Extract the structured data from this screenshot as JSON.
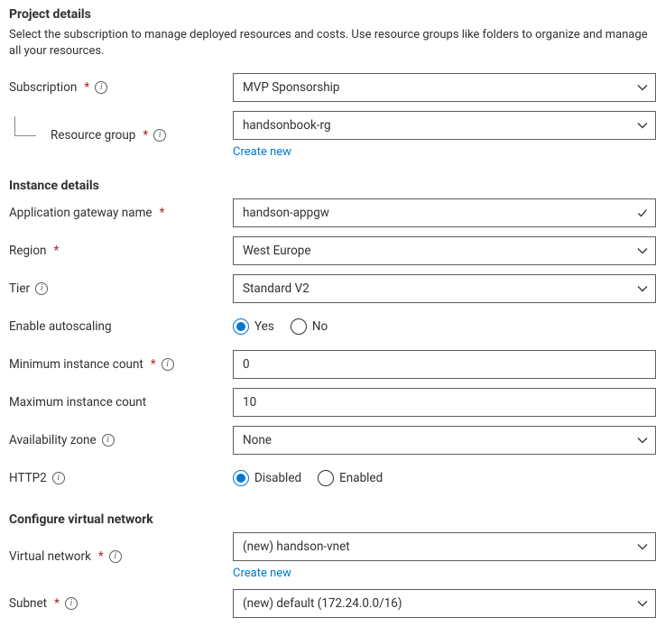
{
  "projectDetails": {
    "heading": "Project details",
    "description": "Select the subscription to manage deployed resources and costs. Use resource groups like folders to organize and manage all your resources.",
    "subscription": {
      "label": "Subscription",
      "value": "MVP Sponsorship"
    },
    "resourceGroup": {
      "label": "Resource group",
      "value": "handsonbook-rg",
      "createNew": "Create new"
    }
  },
  "instanceDetails": {
    "heading": "Instance details",
    "name": {
      "label": "Application gateway name",
      "value": "handson-appgw"
    },
    "region": {
      "label": "Region",
      "value": "West Europe"
    },
    "tier": {
      "label": "Tier",
      "value": "Standard V2"
    },
    "autoscaling": {
      "label": "Enable autoscaling",
      "yes": "Yes",
      "no": "No",
      "selected": "yes"
    },
    "minCount": {
      "label": "Minimum instance count",
      "value": "0"
    },
    "maxCount": {
      "label": "Maximum instance count",
      "value": "10"
    },
    "availabilityZone": {
      "label": "Availability zone",
      "value": "None"
    },
    "http2": {
      "label": "HTTP2",
      "disabled": "Disabled",
      "enabled": "Enabled",
      "selected": "disabled"
    }
  },
  "virtualNetwork": {
    "heading": "Configure virtual network",
    "vnet": {
      "label": "Virtual network",
      "value": "(new) handson-vnet",
      "createNew": "Create new"
    },
    "subnet": {
      "label": "Subnet",
      "value": "(new) default (172.24.0.0/16)"
    }
  },
  "glyphs": {
    "required": "*"
  }
}
